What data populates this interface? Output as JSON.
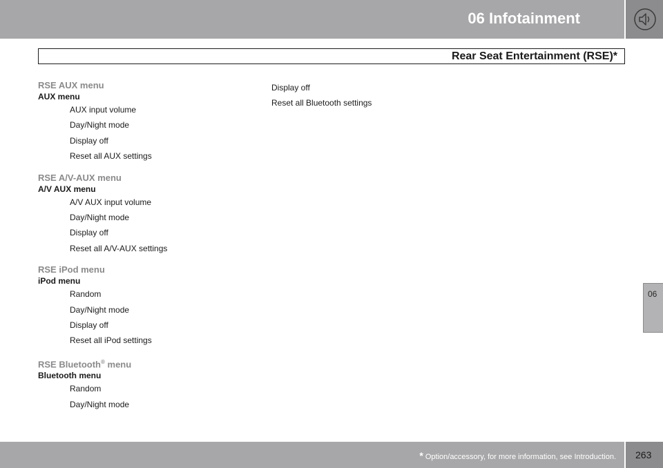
{
  "header": {
    "chapter_title": "06 Infotainment",
    "section_title": "Rear Seat Entertainment (RSE)*",
    "icon": "speaker-icon"
  },
  "side_tab": {
    "label": "06"
  },
  "menus": [
    {
      "heading": "RSE AUX menu",
      "subheading": "AUX menu",
      "items": [
        "AUX input volume",
        "Day/Night mode",
        "Display off",
        "Reset all AUX settings"
      ]
    },
    {
      "heading": "RSE A/V-AUX menu",
      "subheading": "A/V AUX menu",
      "items": [
        "A/V AUX input volume",
        "Day/Night mode",
        "Display off",
        "Reset all A/V-AUX settings"
      ]
    },
    {
      "heading": "RSE iPod menu",
      "subheading": "iPod menu",
      "items": [
        "Random",
        "Day/Night mode",
        "Display off",
        "Reset all iPod settings"
      ]
    },
    {
      "heading": "RSE Bluetooth",
      "heading_sup": "®",
      "heading_tail": " menu",
      "subheading": "Bluetooth menu",
      "items": [
        "Random",
        "Day/Night mode"
      ]
    }
  ],
  "right_column": {
    "items": [
      "Display off",
      "Reset all Bluetooth settings"
    ]
  },
  "footer": {
    "asterisk": "*",
    "footnote": " Option/accessory, for more information, see Introduction.",
    "page_number": "263"
  }
}
